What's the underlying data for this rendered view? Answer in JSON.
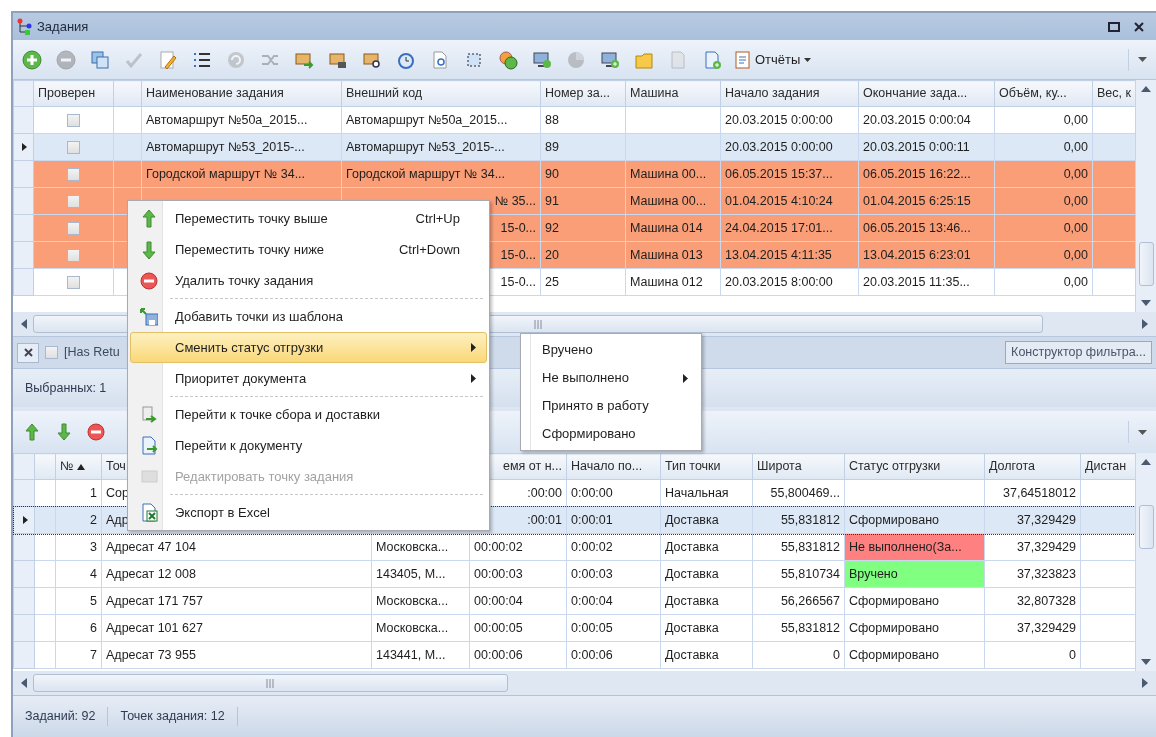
{
  "window": {
    "title": "Задания"
  },
  "toolbar": {
    "buttons": [
      {
        "kind": "add",
        "disabled": false
      },
      {
        "kind": "remove",
        "disabled": true
      },
      {
        "kind": "copy",
        "disabled": false
      },
      {
        "kind": "check",
        "disabled": true
      },
      {
        "kind": "edit",
        "disabled": false
      },
      {
        "kind": "list",
        "disabled": false
      },
      {
        "kind": "refresh",
        "disabled": true
      },
      {
        "kind": "shuffle",
        "disabled": true
      },
      {
        "kind": "box-arrow",
        "disabled": false
      },
      {
        "kind": "box-lock",
        "disabled": false
      },
      {
        "kind": "box-search",
        "disabled": false
      },
      {
        "kind": "clock",
        "disabled": false
      },
      {
        "kind": "page-search",
        "disabled": false
      },
      {
        "kind": "selection",
        "disabled": false
      },
      {
        "kind": "coins",
        "disabled": false
      },
      {
        "kind": "monitor",
        "disabled": false
      },
      {
        "kind": "pie",
        "disabled": true
      },
      {
        "kind": "monitor-add",
        "disabled": false
      },
      {
        "kind": "folder",
        "disabled": false
      },
      {
        "kind": "doc-edit",
        "disabled": true
      },
      {
        "kind": "doc-add",
        "disabled": false
      }
    ],
    "reports_menu": "Отчёты"
  },
  "tasks_table": {
    "columns": [
      "Проверен",
      null,
      "Наименование задания",
      "Внешний код",
      "Номер за...",
      "Машина",
      "Начало задания",
      "Окончание зада...",
      "Объём, ку...",
      "Вес, к"
    ],
    "rows": [
      {
        "current": false,
        "cells": [
          {
            "checked": false
          },
          null,
          "Автомаршрут №50a_2015...",
          "Автомаршрут №50a_2015...",
          "88",
          null,
          "20.03.2015 0:00:00",
          "20.03.2015 0:00:04",
          "0,00",
          null
        ]
      },
      {
        "current": true,
        "cells": [
          {
            "checked": false
          },
          null,
          "Автомаршрут №53_2015-...",
          "Автомаршрут №53_2015-...",
          "89",
          null,
          "20.03.2015 0:00:00",
          "20.03.2015 0:00:11",
          "0,00",
          null
        ]
      },
      {
        "current": false,
        "color": "#fa9e78",
        "cells": [
          {
            "checked": false
          },
          null,
          "Городской маршрут № 34...",
          "Городской маршрут № 34...",
          "90",
          "Машина 00...",
          "06.05.2015 15:37...",
          "06.05.2015 16:22...",
          "0,00",
          null
        ]
      },
      {
        "current": false,
        "color": "#fa9e78",
        "cells": [
          {
            "checked": false
          },
          null,
          null,
          {
            "text": "№ 35...",
            "cut_start": true
          },
          "91",
          "Машина 00...",
          "01.04.2015 4:10:24",
          "01.04.2015 6:25:15",
          "0,00",
          null
        ]
      },
      {
        "current": false,
        "color": "#fa9e78",
        "cells": [
          {
            "checked": false
          },
          null,
          null,
          {
            "text": "15-0...",
            "cut_start": true
          },
          "92",
          "Машина 014",
          "24.04.2015 17:01...",
          "06.05.2015 13:46...",
          "0,00",
          null
        ]
      },
      {
        "current": false,
        "color": "#fa9e78",
        "cells": [
          {
            "checked": false
          },
          null,
          null,
          {
            "text": "15-0...",
            "cut_start": true
          },
          "20",
          "Машина 013",
          "13.04.2015 4:11:35",
          "13.04.2015 6:23:01",
          "0,00",
          null
        ]
      },
      {
        "current": false,
        "cells": [
          {
            "checked": false
          },
          null,
          null,
          {
            "text": "15-0...",
            "cut_start": true
          },
          "25",
          "Машина 012",
          "20.03.2015 8:00:00",
          "20.03.2015 11:35...",
          "0,00",
          null
        ]
      }
    ]
  },
  "filter_bar": {
    "enabled": false,
    "text": "[Has Retu",
    "builder_button": "Конструктор фильтра..."
  },
  "selection_bar": {
    "text": "Выбранных: 1"
  },
  "points_toolbar": {
    "buttons": [
      {
        "kind": "up"
      },
      {
        "kind": "down"
      },
      {
        "kind": "delete"
      }
    ]
  },
  "points_table": {
    "columns": [
      null,
      {
        "text": "№",
        "sorted_ascending": true
      },
      {
        "text": "Точ"
      },
      null,
      {
        "text": "емя от н...",
        "cut_start": true
      },
      {
        "text": "Начало по..."
      },
      {
        "text": "Тип точки"
      },
      {
        "text": "Широта"
      },
      {
        "text": "Статус отгрузки"
      },
      {
        "text": "Долгота"
      },
      {
        "text": "Дистан"
      }
    ],
    "rows": [
      {
        "current": false,
        "cells": [
          null,
          "1",
          "Сор",
          null,
          {
            "text": ":00:00",
            "cut_start": true
          },
          "0:00:00",
          "Начальная",
          "55,800469...",
          null,
          "37,64518012",
          null
        ]
      },
      {
        "current": true,
        "cells": [
          null,
          "2",
          "Адр",
          null,
          {
            "text": ":00:01",
            "cut_start": true
          },
          "0:00:01",
          "Доставка",
          "55,831812",
          "Сформировано",
          "37,329429",
          null
        ]
      },
      {
        "current": false,
        "cells": [
          null,
          "3",
          "Адресат 47 104",
          "Московска...",
          "00:00:02",
          "0:00:02",
          "Доставка",
          "55,831812",
          {
            "text": "Не выполнено(За...",
            "color": "#ff8080"
          },
          "37,329429",
          null
        ]
      },
      {
        "current": false,
        "cells": [
          null,
          "4",
          "Адресат 12 008",
          "143405, М...",
          "00:00:03",
          "0:00:03",
          "Доставка",
          "55,810734",
          {
            "text": "Вручено",
            "color": "#80ff80"
          },
          "37,323823",
          null
        ]
      },
      {
        "current": false,
        "cells": [
          null,
          "5",
          "Адресат 171 757",
          "Московска...",
          "00:00:04",
          "0:00:04",
          "Доставка",
          "56,266567",
          "Сформировано",
          "32,807328",
          null
        ]
      },
      {
        "current": false,
        "cells": [
          null,
          "6",
          "Адресат 101 627",
          "Московска...",
          "00:00:05",
          "0:00:05",
          "Доставка",
          "55,831812",
          "Сформировано",
          "37,329429",
          null
        ]
      },
      {
        "current": false,
        "cells": [
          null,
          "7",
          "Адресат 73 955",
          "143441, М...",
          "00:00:06",
          "0:00:06",
          "Доставка",
          "0",
          "Сформировано",
          "0",
          null
        ]
      }
    ]
  },
  "context_menu": {
    "items": [
      {
        "kind": "item",
        "label": "Переместить точку выше",
        "shortcut": "Ctrl+Up",
        "submenu": false,
        "selected": false,
        "disabled": false
      },
      {
        "kind": "item",
        "label": "Переместить точку ниже",
        "shortcut": "Ctrl+Down",
        "submenu": false,
        "selected": false,
        "disabled": false
      },
      {
        "kind": "item",
        "label": "Удалить точку задания",
        "submenu": false,
        "selected": false,
        "disabled": false
      },
      {
        "kind": "separator"
      },
      {
        "kind": "item",
        "label": "Добавить точки из шаблона",
        "submenu": false,
        "selected": false,
        "disabled": false
      },
      {
        "kind": "item",
        "label": "Сменить статус отгрузки",
        "submenu": true,
        "selected": true,
        "disabled": false
      },
      {
        "kind": "item",
        "label": "Приоритет документа",
        "submenu": true,
        "selected": false,
        "disabled": false
      },
      {
        "kind": "separator"
      },
      {
        "kind": "item",
        "label": "Перейти к точке сбора и доставки",
        "submenu": false,
        "selected": false,
        "disabled": false
      },
      {
        "kind": "item",
        "label": "Перейти к документу",
        "submenu": false,
        "selected": false,
        "disabled": false
      },
      {
        "kind": "item",
        "label": "Редактировать точку задания",
        "submenu": false,
        "selected": false,
        "disabled": true
      },
      {
        "kind": "separator"
      },
      {
        "kind": "item",
        "label": "Экспорт в Excel",
        "submenu": false,
        "selected": false,
        "disabled": false
      }
    ]
  },
  "submenu": {
    "items": [
      {
        "label": "Вручено",
        "submenu": false
      },
      {
        "label": "Не выполнено",
        "submenu": true
      },
      {
        "label": "Принято в работу",
        "submenu": false
      },
      {
        "label": "Сформировано",
        "submenu": false
      }
    ]
  },
  "status_bar": [
    "Заданий: 92",
    "Точек задания: 12"
  ]
}
